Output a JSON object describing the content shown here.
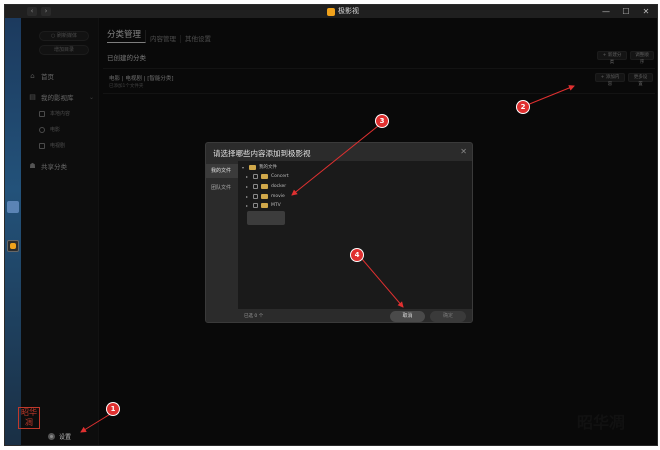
{
  "app": {
    "title": "极影视"
  },
  "window_controls": {
    "minimize": "—",
    "maximize": "☐",
    "close": "✕"
  },
  "nav": {
    "back": "‹",
    "forward": "›"
  },
  "sidebar": {
    "pill_top": "○ 刷新媒体",
    "pill_second": "增加目录",
    "home": "首页",
    "library": "我的影视库",
    "sub_items": [
      "本地内容",
      "电影",
      "电视剧"
    ],
    "share": "共享分类",
    "settings": "设置"
  },
  "main": {
    "tabs": [
      "分类管理",
      "内容管理",
      "其他设置"
    ],
    "section_title": "已创建的分类",
    "btn_new_category": "+ 新建分类",
    "btn_sort": "调整顺序",
    "category": {
      "name": "电影 | 电视剧 | [智能分类]",
      "sub": "已添加1个文件夹"
    },
    "btn_add_content": "+ 添加内容",
    "btn_more_settings": "更多设置"
  },
  "dialog": {
    "title": "请选择哪些内容添加到极影视",
    "close": "✕",
    "tabs": [
      "我的文件",
      "团队文件"
    ],
    "tree": {
      "root": "我的文件",
      "folders": [
        "Concert",
        "docker",
        "movie",
        "MTV"
      ]
    },
    "selected_count": "已选 0 个",
    "cancel": "取消",
    "confirm": "确定"
  },
  "annotations": [
    "1",
    "2",
    "3",
    "4"
  ],
  "watermark": "昭华凋",
  "seal_text": "昭华凋",
  "colors": {
    "accent": "#f0a21c",
    "annotation": "#e03030",
    "background": "#121212"
  }
}
